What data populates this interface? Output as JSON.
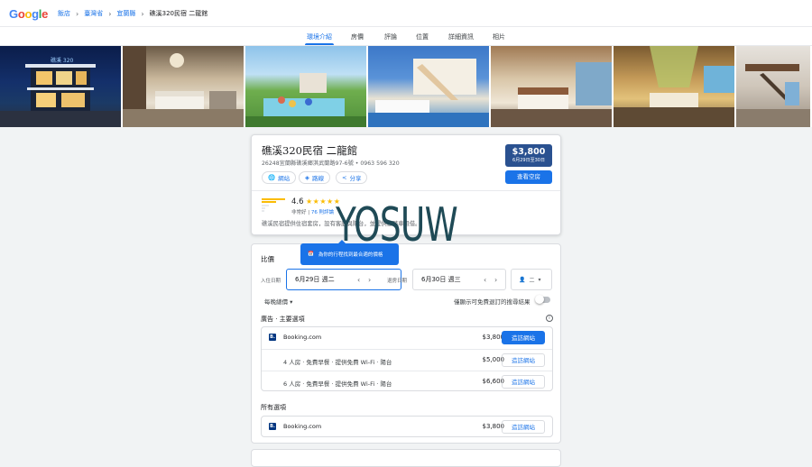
{
  "header": {
    "logo": "Google",
    "logo_colors": [
      "#4285f4",
      "#ea4335",
      "#fbbc05",
      "#4285f4",
      "#34a853",
      "#ea4335"
    ],
    "breadcrumbs": [
      "飯店",
      "臺灣省",
      "宜蘭縣"
    ],
    "current": "礁溪320民宿 二龍館"
  },
  "tabs": [
    "環境介紹",
    "房價",
    "評論",
    "位置",
    "詳細資訊",
    "相片"
  ],
  "hotel": {
    "name": "礁溪320民宿 二龍館",
    "address": "26248宜蘭縣礁溪鄉淇武蘭路97-6號 • 0963 596 320",
    "buttons": {
      "website": "網站",
      "directions": "路線",
      "share": "分享"
    },
    "price": "$3,800",
    "price_dates": "6月29日至30日",
    "book_label": "查看空房",
    "rating": "4.6",
    "stars": "★★★★★",
    "rating_label": "非常好",
    "review_count": "76 則評論",
    "description": "礁溪民宿提供住宿套房，設有客庭與陽台，並提供腳踏車租借。"
  },
  "watermark": "YOSUW",
  "compare": {
    "title": "比價",
    "tooltip": "為你的行程找到最合適的價格",
    "checkin_label": "入住日期",
    "checkin_value": "6月29日 週二",
    "checkout_label": "退房日期",
    "checkout_value": "6月30日 週三",
    "guests_value": "二",
    "per_night": "每晚總價",
    "free_cancel": "僅顯示可免費退訂的搜尋結果",
    "featured_title": "廣告 · 主要選項",
    "offers": [
      {
        "site": "Booking.com",
        "desc": "",
        "price": "$3,800",
        "btn": "造訪網站"
      },
      {
        "site": "",
        "desc": "4 人房 · 免費早餐 · 提供免費 Wi-Fi · 陽台",
        "price": "$5,000",
        "btn": "造訪網站"
      },
      {
        "site": "",
        "desc": "6 人房 · 免費早餐 · 提供免費 Wi-Fi · 陽台",
        "price": "$6,600",
        "btn": "造訪網站"
      }
    ],
    "all_title": "所有選項",
    "all_offer": {
      "site": "Booking.com",
      "price": "$3,800",
      "btn": "造訪網站"
    }
  }
}
